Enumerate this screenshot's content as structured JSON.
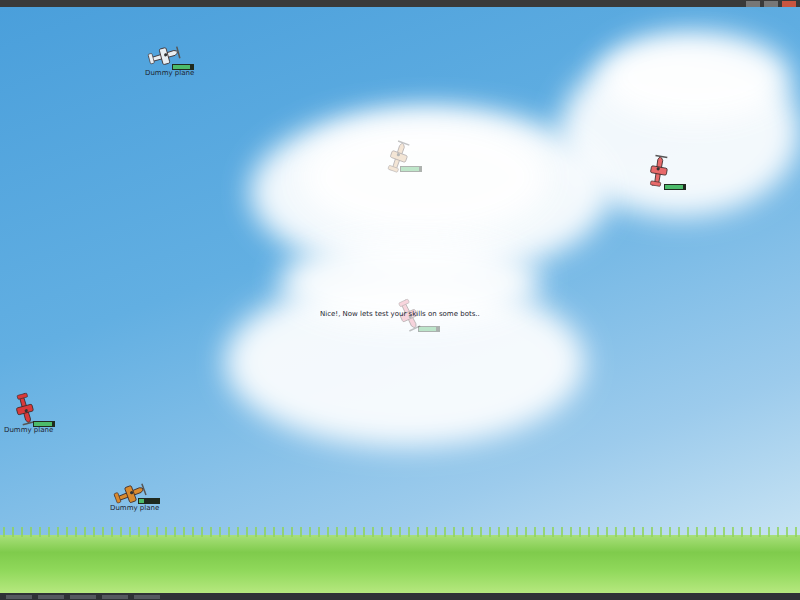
{
  "planes": [
    {
      "label": "Dummy plane",
      "health": 0.85,
      "color": "#e8eef2",
      "faded": false
    },
    {
      "health": 0.9,
      "color": "#e3b98a",
      "faded": true
    },
    {
      "health": 0.9,
      "color": "#e86a6a",
      "faded": false
    },
    {
      "health": 0.85,
      "color": "#f08aa0",
      "faded": true
    },
    {
      "label": "Dummy plane",
      "health": 0.9,
      "color": "#d93a3a",
      "faded": false
    },
    {
      "label": "Dummy plane",
      "health": 0.25,
      "color": "#d98a2e",
      "faded": false
    }
  ],
  "message": "Nice!, Now lets test your skills on some bots.."
}
